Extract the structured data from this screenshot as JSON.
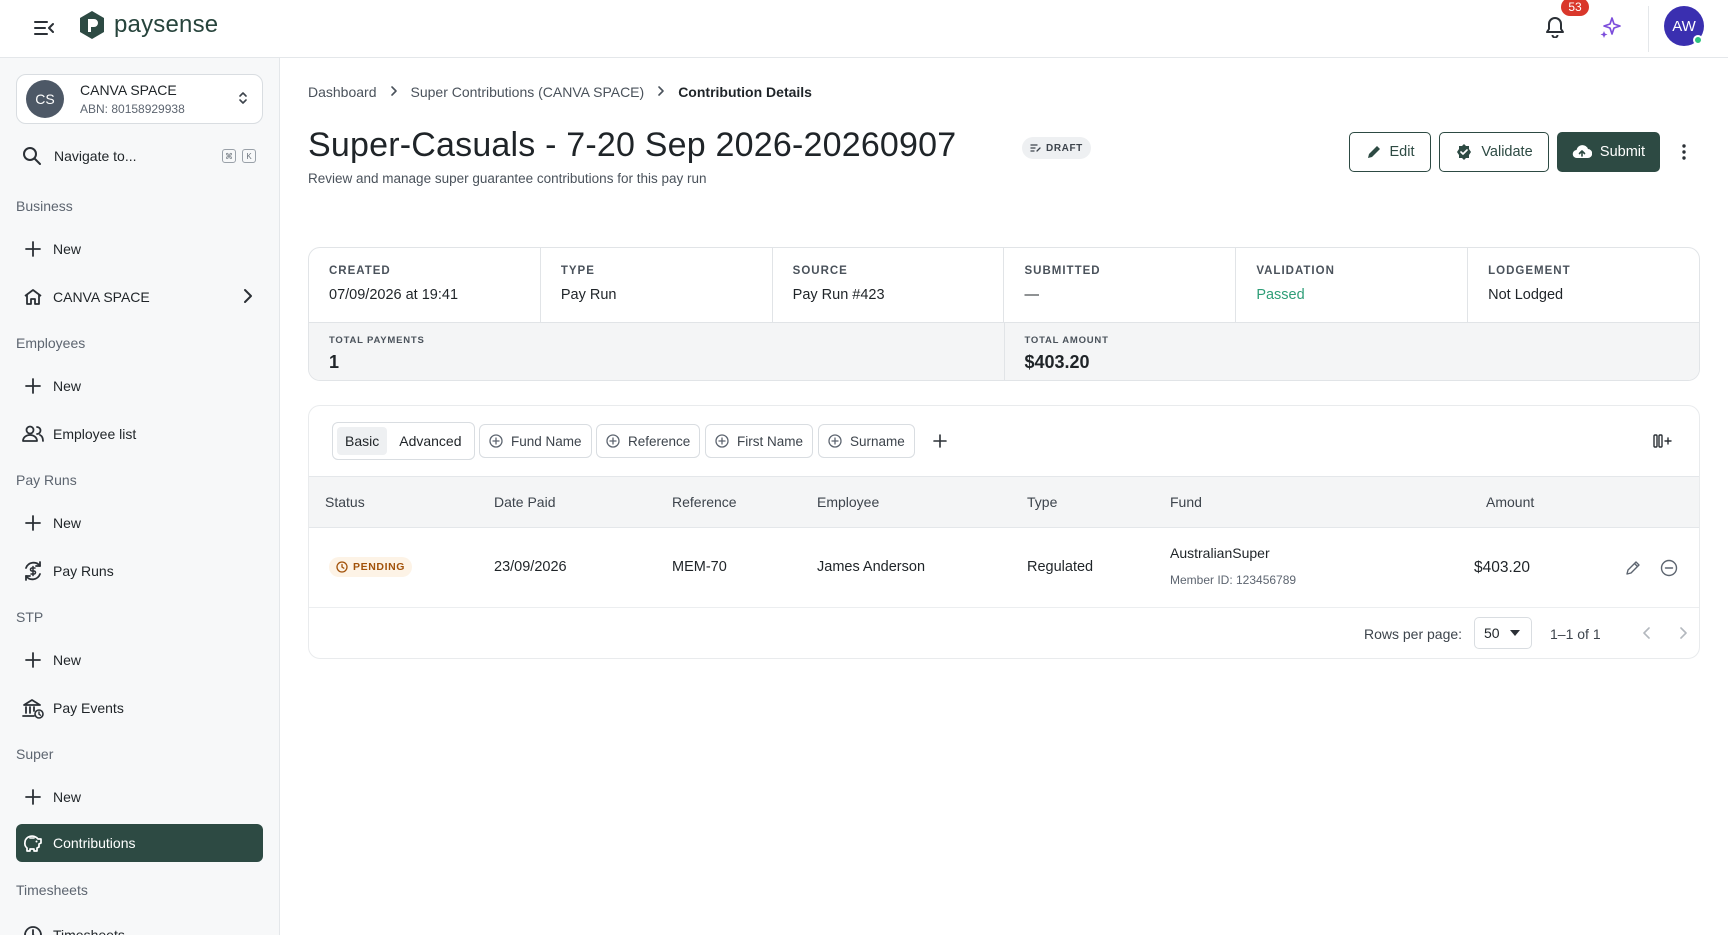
{
  "app": {
    "brand": "paysense",
    "notifications_count": "53",
    "user_initials": "AW"
  },
  "sidebar": {
    "org": {
      "initials": "CS",
      "name": "CANVA SPACE",
      "abn": "ABN: 80158929938"
    },
    "search": {
      "label": "Navigate to...",
      "kbd_1": "⌘",
      "kbd_2": "K"
    },
    "sections": {
      "business": "Business",
      "employees": "Employees",
      "pay_runs": "Pay Runs",
      "stp": "STP",
      "super": "Super",
      "timesheets": "Timesheets"
    },
    "items": {
      "business_new": "New",
      "canva_space": "CANVA SPACE",
      "employees_new": "New",
      "employee_list": "Employee list",
      "pay_runs_new": "New",
      "pay_runs": "Pay Runs",
      "stp_new": "New",
      "pay_events": "Pay Events",
      "super_new": "New",
      "contributions": "Contributions",
      "timesheets": "Timesheets"
    }
  },
  "breadcrumb": {
    "items": [
      "Dashboard",
      "Super Contributions (CANVA SPACE)",
      "Contribution Details"
    ]
  },
  "page": {
    "title": "Super-Casuals - 7-20 Sep 2026-20260907",
    "status_chip": "DRAFT",
    "subtitle": "Review and manage super guarantee contributions for this pay run"
  },
  "actions": {
    "edit": "Edit",
    "validate": "Validate",
    "submit": "Submit"
  },
  "summary": {
    "created": {
      "label": "CREATED",
      "value": "07/09/2026 at 19:41"
    },
    "type": {
      "label": "TYPE",
      "value": "Pay Run"
    },
    "source": {
      "label": "SOURCE",
      "value": "Pay Run #423"
    },
    "submitted": {
      "label": "SUBMITTED",
      "value": "—"
    },
    "validation": {
      "label": "VALIDATION",
      "value": "Passed"
    },
    "lodgement": {
      "label": "LODGEMENT",
      "value": "Not Lodged"
    },
    "total_payments": {
      "label": "TOTAL PAYMENTS",
      "value": "1"
    },
    "total_amount": {
      "label": "TOTAL AMOUNT",
      "value": "$403.20"
    }
  },
  "table": {
    "view_toggle": [
      "Basic",
      "Advanced"
    ],
    "filters": [
      "Fund Name",
      "Reference",
      "First Name",
      "Surname"
    ],
    "columns": [
      "Status",
      "Date Paid",
      "Reference",
      "Employee",
      "Type",
      "Fund",
      "Amount"
    ],
    "rows": [
      {
        "status": "PENDING",
        "date_paid": "23/09/2026",
        "reference": "MEM-70",
        "employee": "James Anderson",
        "type": "Regulated",
        "fund": "AustralianSuper",
        "member_id": "Member ID: 123456789",
        "amount": "$403.20"
      }
    ],
    "pagination": {
      "rows_per_page_label": "Rows per page:",
      "rows_per_page": "50",
      "range": "1–1 of 1"
    }
  },
  "colors": {
    "brand": "#2d4a43",
    "passed": "#2f9e78",
    "pending": "#a2520a",
    "notification": "#d9372b",
    "avatar": "#3a2fb0"
  }
}
